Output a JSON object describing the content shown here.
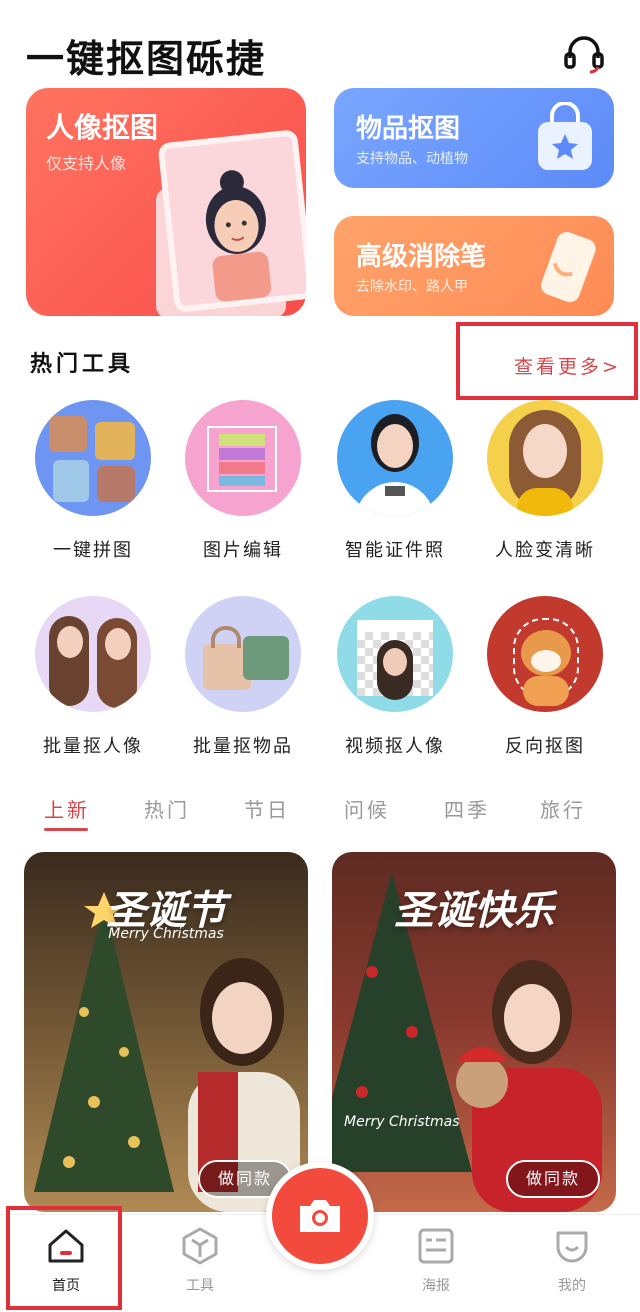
{
  "header": {
    "title": "一键抠图砾捷",
    "support_icon": "headset-icon"
  },
  "hero": {
    "title": "人像抠图",
    "subtitle": "仅支持人像"
  },
  "cards": [
    {
      "title": "物品抠图",
      "subtitle": "支持物品、动植物",
      "icon": "shopping-bag-icon",
      "color": "#6f9bfb"
    },
    {
      "title": "高级消除笔",
      "subtitle": "去除水印、路人甲",
      "icon": "eraser-icon",
      "color": "#ff9a62"
    }
  ],
  "section": {
    "title": "热门工具",
    "more": "查看更多>"
  },
  "tools": [
    {
      "label": "一键拼图"
    },
    {
      "label": "图片编辑"
    },
    {
      "label": "智能证件照"
    },
    {
      "label": "人脸变清晰"
    },
    {
      "label": "批量抠人像"
    },
    {
      "label": "批量抠物品"
    },
    {
      "label": "视频抠人像"
    },
    {
      "label": "反向抠图"
    }
  ],
  "tabs": [
    "上新",
    "热门",
    "节日",
    "问候",
    "四季",
    "旅行"
  ],
  "posters": [
    {
      "title": "圣诞节",
      "subtitle": "Merry Christmas",
      "button": "做同款"
    },
    {
      "title": "圣诞快乐",
      "subtitle": "Merry Christmas",
      "button": "做同款"
    }
  ],
  "nav": [
    {
      "label": "首页",
      "icon": "home-icon"
    },
    {
      "label": "工具",
      "icon": "cube-icon"
    },
    {
      "label": "",
      "icon": "camera-icon"
    },
    {
      "label": "海报",
      "icon": "poster-icon"
    },
    {
      "label": "我的",
      "icon": "smile-icon"
    }
  ],
  "colors": {
    "accent": "#d8464a",
    "hero": "#f94d4a",
    "camera": "#f24a3c"
  }
}
